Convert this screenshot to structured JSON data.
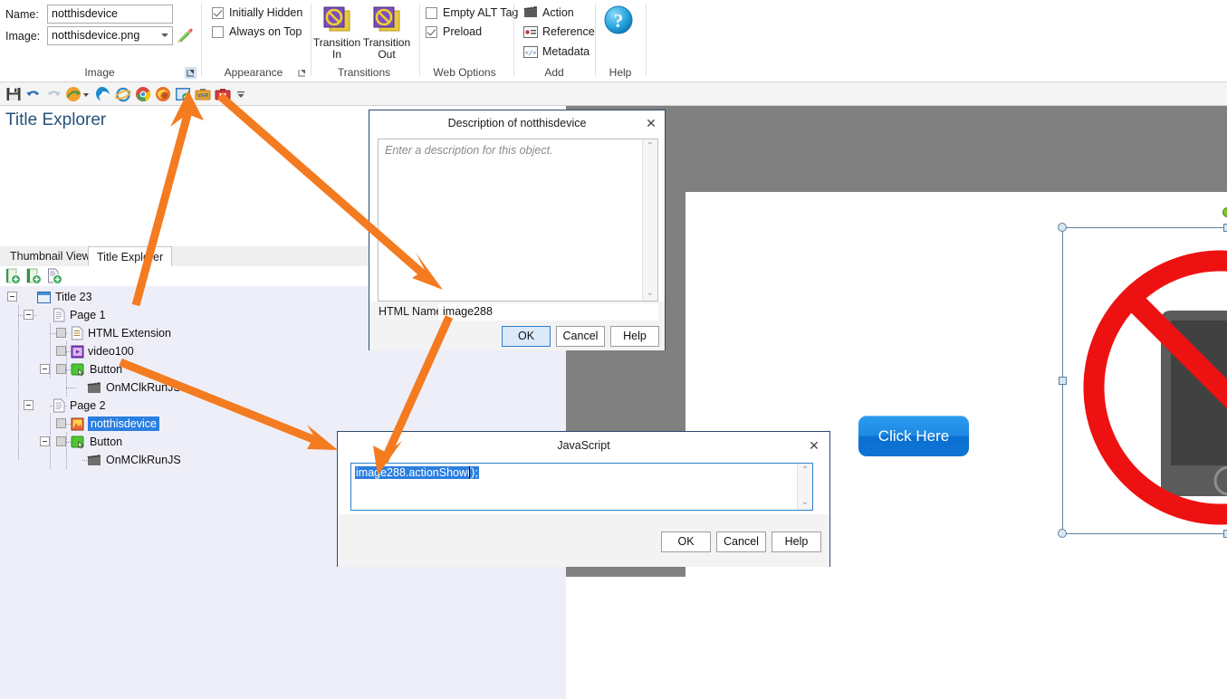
{
  "ribbon": {
    "image_group": {
      "name_label": "Name:",
      "name_value": "notthisdevice",
      "image_label": "Image:",
      "image_value": "notthisdevice.png",
      "group_label": "Image",
      "edit_icon": "pencil-icon",
      "launcher_icon": "dialog-launcher-icon"
    },
    "appearance_group": {
      "initially_hidden_label": "Initially Hidden",
      "initially_hidden_checked": true,
      "always_on_top_label": "Always on Top",
      "always_on_top_checked": false,
      "group_label": "Appearance",
      "launcher_icon": "dialog-launcher-icon"
    },
    "transitions_group": {
      "transition_in_label": "Transition\nIn",
      "transition_in_line1": "Transition",
      "transition_in_line2": "In",
      "transition_out_line1": "Transition",
      "transition_out_line2": "Out",
      "group_label": "Transitions",
      "icon": "no-transition-icon"
    },
    "web_options_group": {
      "empty_alt_tag_label": "Empty ALT Tag",
      "empty_alt_tag_checked": false,
      "preload_label": "Preload",
      "preload_checked": true,
      "group_label": "Web Options"
    },
    "add_group": {
      "items": [
        {
          "label": "Action",
          "icon": "clapperboard-icon"
        },
        {
          "label": "Reference",
          "icon": "reference-card-icon"
        },
        {
          "label": "Metadata",
          "icon": "code-tag-icon"
        }
      ],
      "group_label": "Add"
    },
    "help_group": {
      "group_label": "Help",
      "icon": "help-question-icon"
    }
  },
  "quick_toolbar": {
    "items": [
      {
        "name": "save-icon",
        "title": "Save"
      },
      {
        "name": "undo-icon",
        "title": "Undo"
      },
      {
        "name": "redo-icon",
        "title": "Redo"
      },
      {
        "name": "publish-icon",
        "title": "Publish"
      },
      {
        "name": "dropdown-arrow-icon",
        "title": "More"
      },
      {
        "name": "edge-browser-icon",
        "title": "Preview in Edge"
      },
      {
        "name": "internet-explorer-icon",
        "title": "Preview in Internet Explorer"
      },
      {
        "name": "chrome-browser-icon",
        "title": "Preview in Chrome"
      },
      {
        "name": "firefox-browser-icon",
        "title": "Preview in Firefox"
      },
      {
        "name": "preview-page-icon",
        "title": "Preview Page"
      },
      {
        "name": "variables-icon",
        "title": "Variables"
      },
      {
        "name": "toolbox-icon",
        "title": "Toolbox"
      },
      {
        "name": "overflow-chevron-icon",
        "title": "More commands"
      }
    ]
  },
  "left_panel": {
    "title": "Title Explorer",
    "tabs": [
      {
        "label": "Thumbnail View",
        "active": false
      },
      {
        "label": "Title Explorer",
        "active": true
      }
    ],
    "tree_toolbar": [
      {
        "name": "add-chapter-icon"
      },
      {
        "name": "add-section-icon"
      },
      {
        "name": "add-page-icon"
      }
    ],
    "tree": [
      {
        "label": "Title 23",
        "depth": 0,
        "icon": "title-book-icon",
        "expanded": true,
        "selected": false
      },
      {
        "label": "Page 1",
        "depth": 1,
        "icon": "page-icon",
        "expanded": true,
        "selected": false
      },
      {
        "label": "HTML Extension",
        "depth": 2,
        "icon": "html-extension-icon",
        "expanded": false,
        "selected": false
      },
      {
        "label": "video100",
        "depth": 2,
        "icon": "video-icon",
        "expanded": false,
        "selected": false
      },
      {
        "label": "Button",
        "depth": 2,
        "icon": "button-icon",
        "expanded": true,
        "selected": false
      },
      {
        "label": "OnMClkRunJS",
        "depth": 3,
        "icon": "action-clapper-icon",
        "expanded": false,
        "selected": false
      },
      {
        "label": "Page 2",
        "depth": 1,
        "icon": "page-icon",
        "expanded": true,
        "selected": false
      },
      {
        "label": "notthisdevice",
        "depth": 2,
        "icon": "image-icon",
        "expanded": false,
        "selected": true
      },
      {
        "label": "Button",
        "depth": 2,
        "icon": "button-icon",
        "expanded": true,
        "selected": false
      },
      {
        "label": "OnMClkRunJS",
        "depth": 3,
        "icon": "action-clapper-icon",
        "expanded": false,
        "selected": false
      }
    ]
  },
  "canvas": {
    "click_button_label": "Click Here",
    "selected_object": "notthisdevice",
    "image_alt": "no-mobile-device-graphic"
  },
  "description_dialog": {
    "title": "Description of notthisdevice",
    "close_icon": "close-icon",
    "description_placeholder": "Enter a description for this object.",
    "description_value": "",
    "html_name_label": "HTML Name:",
    "html_name_value": "image288",
    "buttons": {
      "ok": "OK",
      "cancel": "Cancel",
      "help": "Help"
    }
  },
  "javascript_dialog": {
    "title": "JavaScript",
    "close_icon": "close-icon",
    "code_value": "image288.actionShow();",
    "buttons": {
      "ok": "OK",
      "cancel": "Cancel",
      "help": "Help"
    }
  },
  "colors": {
    "accent_orange": "#F47B20",
    "selection_blue": "#2a7fe0",
    "canvas_gray": "#808080",
    "tree_bg": "#eeeef8",
    "title_blue": "#27527b"
  }
}
